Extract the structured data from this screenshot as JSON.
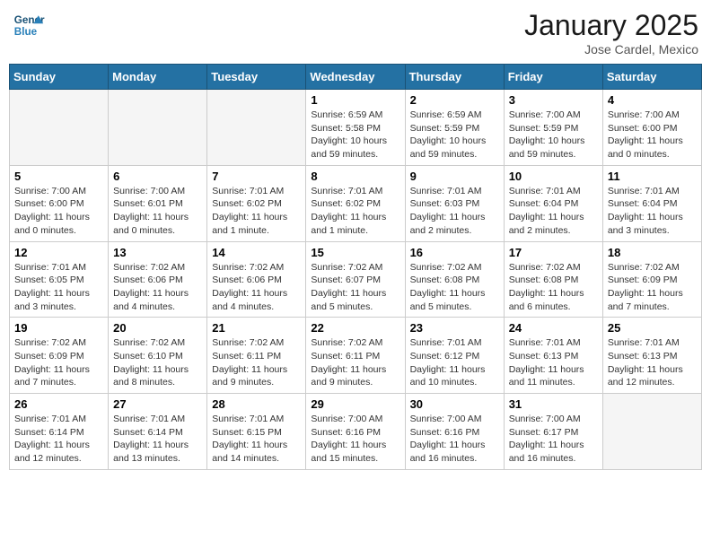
{
  "header": {
    "logo": {
      "line1": "General",
      "line2": "Blue"
    },
    "title": "January 2025",
    "location": "Jose Cardel, Mexico"
  },
  "days_of_week": [
    "Sunday",
    "Monday",
    "Tuesday",
    "Wednesday",
    "Thursday",
    "Friday",
    "Saturday"
  ],
  "weeks": [
    [
      {
        "day": "",
        "info": ""
      },
      {
        "day": "",
        "info": ""
      },
      {
        "day": "",
        "info": ""
      },
      {
        "day": "1",
        "info": "Sunrise: 6:59 AM\nSunset: 5:58 PM\nDaylight: 10 hours\nand 59 minutes."
      },
      {
        "day": "2",
        "info": "Sunrise: 6:59 AM\nSunset: 5:59 PM\nDaylight: 10 hours\nand 59 minutes."
      },
      {
        "day": "3",
        "info": "Sunrise: 7:00 AM\nSunset: 5:59 PM\nDaylight: 10 hours\nand 59 minutes."
      },
      {
        "day": "4",
        "info": "Sunrise: 7:00 AM\nSunset: 6:00 PM\nDaylight: 11 hours\nand 0 minutes."
      }
    ],
    [
      {
        "day": "5",
        "info": "Sunrise: 7:00 AM\nSunset: 6:00 PM\nDaylight: 11 hours\nand 0 minutes."
      },
      {
        "day": "6",
        "info": "Sunrise: 7:00 AM\nSunset: 6:01 PM\nDaylight: 11 hours\nand 0 minutes."
      },
      {
        "day": "7",
        "info": "Sunrise: 7:01 AM\nSunset: 6:02 PM\nDaylight: 11 hours\nand 1 minute."
      },
      {
        "day": "8",
        "info": "Sunrise: 7:01 AM\nSunset: 6:02 PM\nDaylight: 11 hours\nand 1 minute."
      },
      {
        "day": "9",
        "info": "Sunrise: 7:01 AM\nSunset: 6:03 PM\nDaylight: 11 hours\nand 2 minutes."
      },
      {
        "day": "10",
        "info": "Sunrise: 7:01 AM\nSunset: 6:04 PM\nDaylight: 11 hours\nand 2 minutes."
      },
      {
        "day": "11",
        "info": "Sunrise: 7:01 AM\nSunset: 6:04 PM\nDaylight: 11 hours\nand 3 minutes."
      }
    ],
    [
      {
        "day": "12",
        "info": "Sunrise: 7:01 AM\nSunset: 6:05 PM\nDaylight: 11 hours\nand 3 minutes."
      },
      {
        "day": "13",
        "info": "Sunrise: 7:02 AM\nSunset: 6:06 PM\nDaylight: 11 hours\nand 4 minutes."
      },
      {
        "day": "14",
        "info": "Sunrise: 7:02 AM\nSunset: 6:06 PM\nDaylight: 11 hours\nand 4 minutes."
      },
      {
        "day": "15",
        "info": "Sunrise: 7:02 AM\nSunset: 6:07 PM\nDaylight: 11 hours\nand 5 minutes."
      },
      {
        "day": "16",
        "info": "Sunrise: 7:02 AM\nSunset: 6:08 PM\nDaylight: 11 hours\nand 5 minutes."
      },
      {
        "day": "17",
        "info": "Sunrise: 7:02 AM\nSunset: 6:08 PM\nDaylight: 11 hours\nand 6 minutes."
      },
      {
        "day": "18",
        "info": "Sunrise: 7:02 AM\nSunset: 6:09 PM\nDaylight: 11 hours\nand 7 minutes."
      }
    ],
    [
      {
        "day": "19",
        "info": "Sunrise: 7:02 AM\nSunset: 6:09 PM\nDaylight: 11 hours\nand 7 minutes."
      },
      {
        "day": "20",
        "info": "Sunrise: 7:02 AM\nSunset: 6:10 PM\nDaylight: 11 hours\nand 8 minutes."
      },
      {
        "day": "21",
        "info": "Sunrise: 7:02 AM\nSunset: 6:11 PM\nDaylight: 11 hours\nand 9 minutes."
      },
      {
        "day": "22",
        "info": "Sunrise: 7:02 AM\nSunset: 6:11 PM\nDaylight: 11 hours\nand 9 minutes."
      },
      {
        "day": "23",
        "info": "Sunrise: 7:01 AM\nSunset: 6:12 PM\nDaylight: 11 hours\nand 10 minutes."
      },
      {
        "day": "24",
        "info": "Sunrise: 7:01 AM\nSunset: 6:13 PM\nDaylight: 11 hours\nand 11 minutes."
      },
      {
        "day": "25",
        "info": "Sunrise: 7:01 AM\nSunset: 6:13 PM\nDaylight: 11 hours\nand 12 minutes."
      }
    ],
    [
      {
        "day": "26",
        "info": "Sunrise: 7:01 AM\nSunset: 6:14 PM\nDaylight: 11 hours\nand 12 minutes."
      },
      {
        "day": "27",
        "info": "Sunrise: 7:01 AM\nSunset: 6:14 PM\nDaylight: 11 hours\nand 13 minutes."
      },
      {
        "day": "28",
        "info": "Sunrise: 7:01 AM\nSunset: 6:15 PM\nDaylight: 11 hours\nand 14 minutes."
      },
      {
        "day": "29",
        "info": "Sunrise: 7:00 AM\nSunset: 6:16 PM\nDaylight: 11 hours\nand 15 minutes."
      },
      {
        "day": "30",
        "info": "Sunrise: 7:00 AM\nSunset: 6:16 PM\nDaylight: 11 hours\nand 16 minutes."
      },
      {
        "day": "31",
        "info": "Sunrise: 7:00 AM\nSunset: 6:17 PM\nDaylight: 11 hours\nand 16 minutes."
      },
      {
        "day": "",
        "info": ""
      }
    ]
  ]
}
